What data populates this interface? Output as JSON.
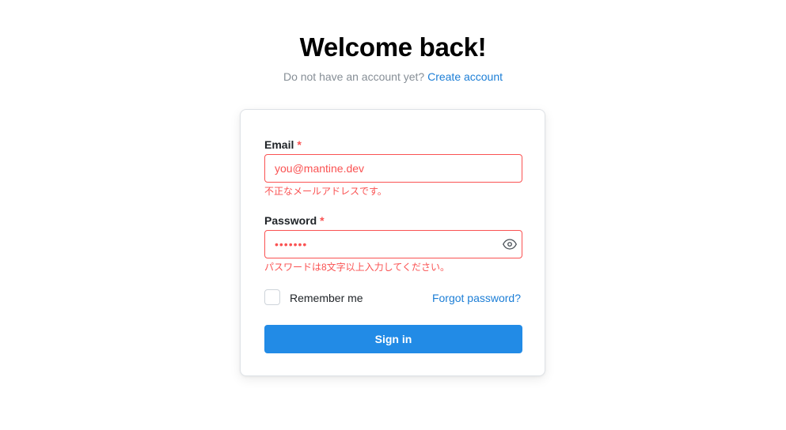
{
  "header": {
    "title": "Welcome back!",
    "subtitle_text": "Do not have an account yet?",
    "create_account_link": "Create account"
  },
  "form": {
    "email": {
      "label": "Email",
      "required_mark": "*",
      "placeholder": "you@mantine.dev",
      "value": "",
      "error": "不正なメールアドレスです。"
    },
    "password": {
      "label": "Password",
      "required_mark": "*",
      "masked_value": "•••••••",
      "error": "パスワードは8文字以上入力してください。",
      "toggle_icon": "eye-icon"
    },
    "remember": {
      "label": "Remember me",
      "checked": false
    },
    "forgot_link": "Forgot password?",
    "submit_label": "Sign in"
  },
  "colors": {
    "accent": "#228be6",
    "link": "#1c7ed6",
    "error": "#fa5252",
    "muted": "#868e96"
  }
}
